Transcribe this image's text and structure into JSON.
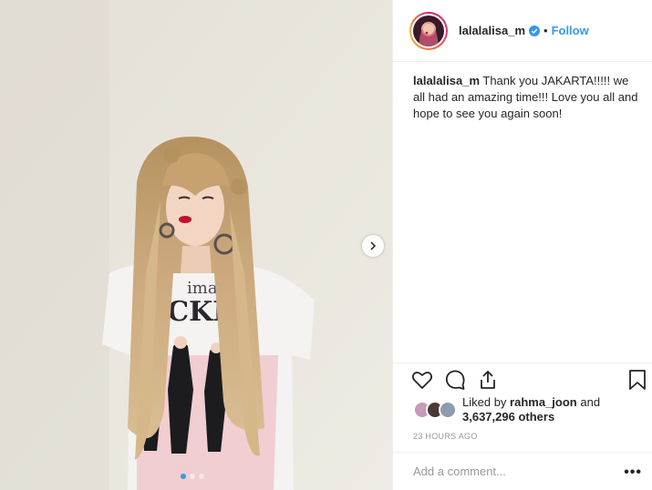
{
  "header": {
    "username": "lalalalisa_m",
    "separator": "•",
    "follow_label": "Follow",
    "verified_icon": "verified-badge-icon"
  },
  "caption": {
    "username": "lalalalisa_m",
    "text": "Thank you JAKARTA!!!!! we all had an amazing time!!! Love you all and hope to see you again soon!"
  },
  "photo": {
    "shirt_text_top": "imac",
    "shirt_text_main": "ACKI"
  },
  "actions": {
    "like_icon": "heart-icon",
    "comment_icon": "comment-bubble-icon",
    "share_icon": "share-icon",
    "save_icon": "bookmark-icon"
  },
  "likes": {
    "prefix": "Liked by",
    "user": "rahma_joon",
    "middle": "and",
    "count": "3,637,296 others"
  },
  "timestamp": "23 HOURS AGO",
  "comment": {
    "placeholder": "Add a comment...",
    "more_label": "•••"
  },
  "carousel": {
    "slides": 3,
    "active": 1
  },
  "colors": {
    "accent": "#3897f0",
    "text": "#262626",
    "muted": "#999999"
  }
}
